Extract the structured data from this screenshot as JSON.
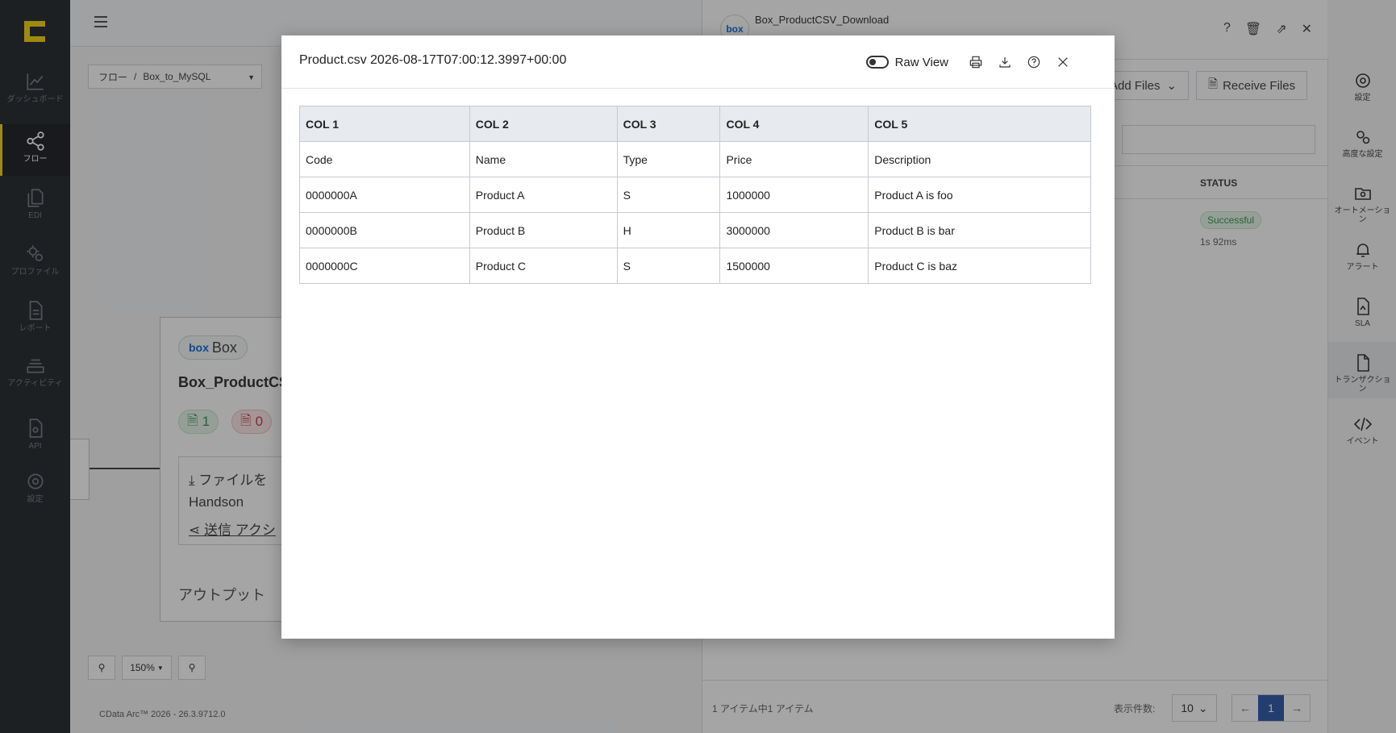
{
  "nav": {
    "items": [
      {
        "label": "ダッシュボード",
        "icon": "chart-icon"
      },
      {
        "label": "フロー",
        "icon": "share-icon"
      },
      {
        "label": "EDI",
        "icon": "documents-icon"
      },
      {
        "label": "プロファイル",
        "icon": "gears-icon"
      },
      {
        "label": "レポート",
        "icon": "report-icon"
      },
      {
        "label": "アクティビティ",
        "icon": "layers-icon"
      },
      {
        "label": "API",
        "icon": "api-icon"
      },
      {
        "label": "設定",
        "icon": "gear-icon"
      }
    ]
  },
  "canvas": {
    "breadcrumb_root": "フロー",
    "breadcrumb_sep": "/",
    "breadcrumb_flow": "Box_to_MySQL",
    "node_badge": "Box",
    "node_badge_logo": "box",
    "node_title": "Box_ProductCS",
    "count_ok": "1",
    "count_err": "0",
    "node_line1": "ファイルを",
    "node_line2": "Handson",
    "node_line3": "送信 アクシ",
    "node_output": "アウトプット",
    "zoom_level": "150%",
    "version": "CData Arc™ 2026 - 26.3.9712.0"
  },
  "panel": {
    "avatar": "box",
    "name": "Box_ProductCSV_Download",
    "add_files": "Add Files",
    "receive_files": "Receive Files",
    "status_header": "STATUS",
    "status": "Successful",
    "duration": "1s 92ms",
    "page_info": "1 アイテム中1 アイテム",
    "per_page_label": "表示件数:",
    "per_page": "10",
    "page": "1"
  },
  "rail": {
    "items": [
      {
        "label": "設定",
        "icon": "gear-icon"
      },
      {
        "label": "高度な設定",
        "icon": "gears-icon"
      },
      {
        "label": "オートメーション",
        "icon": "folder-gear-icon"
      },
      {
        "label": "アラート",
        "icon": "bell-icon"
      },
      {
        "label": "SLA",
        "icon": "sla-doc-icon"
      },
      {
        "label": "トランザクション",
        "icon": "file-icon"
      },
      {
        "label": "イベント",
        "icon": "code-icon"
      }
    ]
  },
  "modal": {
    "title": "Product.csv 2026-08-17T07:00:12.3997+00:00",
    "raw_view_label": "Raw View",
    "table": {
      "headers": [
        "COL 1",
        "COL 2",
        "COL 3",
        "COL 4",
        "COL 5"
      ],
      "rows": [
        [
          "Code",
          "Name",
          "Type",
          "Price",
          "Description"
        ],
        [
          "0000000A",
          "Product A",
          "S",
          "1000000",
          "Product A is foo"
        ],
        [
          "0000000B",
          "Product B",
          "H",
          "3000000",
          "Product B is bar"
        ],
        [
          "0000000C",
          "Product C",
          "S",
          "1500000",
          "Product C is baz"
        ]
      ]
    }
  }
}
